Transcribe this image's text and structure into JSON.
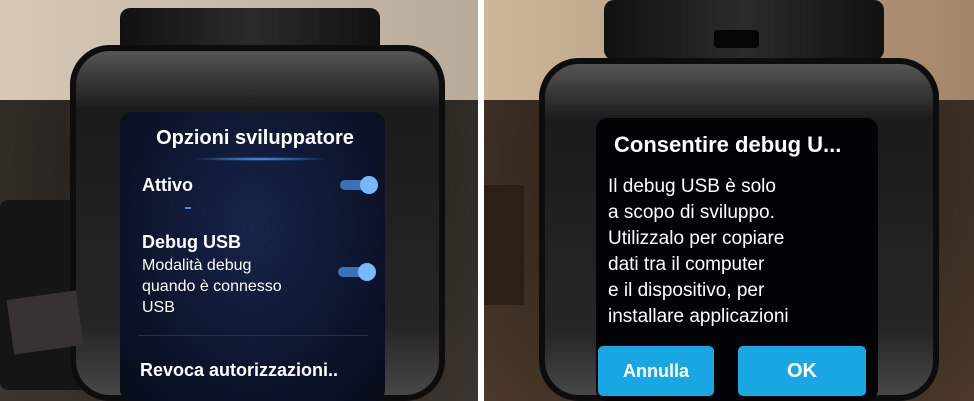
{
  "left_screen": {
    "title": "Opzioni sviluppatore",
    "setting_active": {
      "label": "Attivo",
      "enabled": true
    },
    "setting_debug_usb": {
      "label": "Debug USB",
      "desc_line1": "Modalità debug",
      "desc_line2": "quando è connesso",
      "desc_line3": "USB",
      "enabled": true
    },
    "revoke_label": "Revoca autorizzazioni.."
  },
  "right_screen": {
    "dialog_title": "Consentire debug U...",
    "message_lines": [
      "Il debug USB è solo",
      "a scopo di sviluppo.",
      "Utilizzalo per copiare",
      "dati tra il computer",
      "e il dispositivo, per",
      "installare applicazioni"
    ],
    "cancel_label": "Annulla",
    "ok_label": "OK"
  },
  "colors": {
    "accent_toggle": "#78b8ff",
    "button_blue": "#19a7e4",
    "screen_bg": "#0e1630"
  },
  "icons": [
    "toggle-on-icon",
    "toggle-on-icon"
  ]
}
